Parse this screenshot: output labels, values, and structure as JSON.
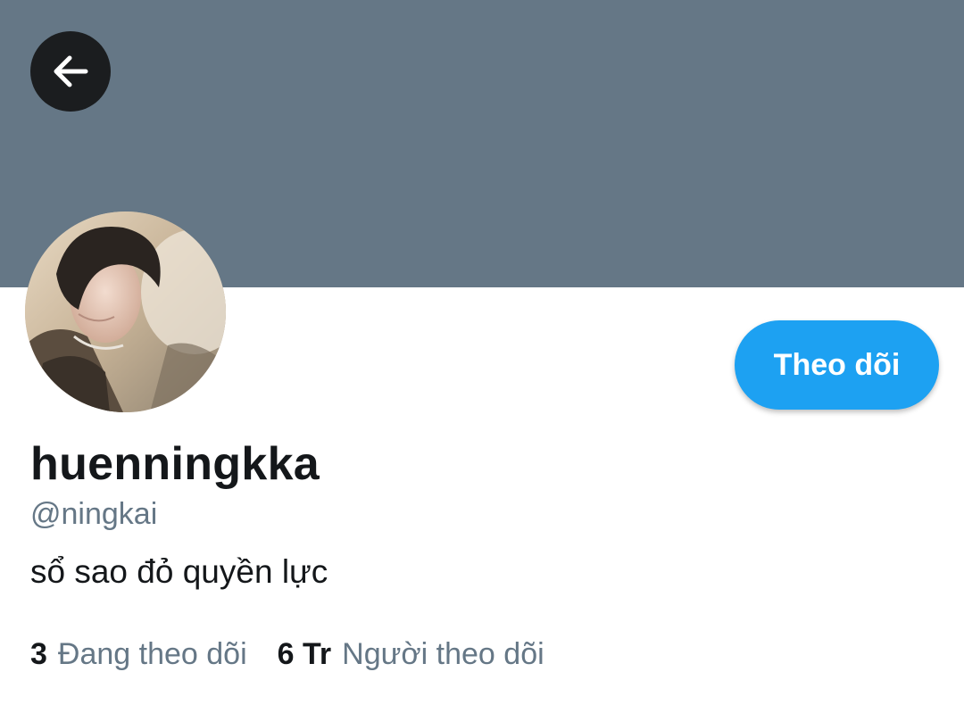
{
  "profile": {
    "display_name": "huenningkka",
    "handle": "@ningkai",
    "bio": "sổ sao đỏ quyền lực"
  },
  "actions": {
    "follow_label": "Theo dõi"
  },
  "stats": {
    "following_count": "3",
    "following_label": "Đang theo dõi",
    "followers_count": "6 Tr",
    "followers_label": "Người theo dõi"
  },
  "colors": {
    "banner": "#657786",
    "accent": "#1da1f2",
    "secondary_text": "#657786",
    "primary_text": "#14171a"
  },
  "icons": {
    "back": "arrow-left-icon"
  }
}
